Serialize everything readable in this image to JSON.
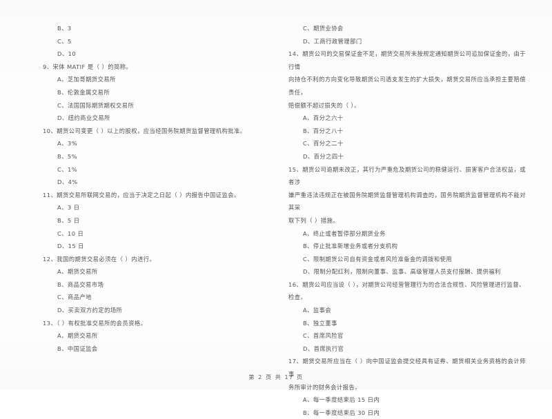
{
  "document": {
    "footer": "第 2 页  共 17 页"
  },
  "left_column": {
    "orphan_options": [
      "B、3",
      "C、5",
      "D、10"
    ],
    "questions": [
      {
        "number": "9",
        "stem_lines": [
          "9、宋体 MATIF 是（     ）的简称。"
        ],
        "options": [
          "A、芝加哥期货交易所",
          "B、伦敦金属交易所",
          "C、法国国际期货期权交易所",
          "D、纽约商业交易所"
        ]
      },
      {
        "number": "10",
        "stem_lines": [
          "10、期货公司变更（     ）以上的股权，应当经国务院期货监督管理机构批准。"
        ],
        "options": [
          "A、3%",
          "B、5%",
          "C、1%",
          "D、4%"
        ]
      },
      {
        "number": "11",
        "stem_lines": [
          "11、期货交易所联网交易的，应当于决定之日起（     ）内报告中国证监会。"
        ],
        "options": [
          "A、3 日",
          "B、5 日",
          "C、10 日",
          "D、15 日"
        ]
      },
      {
        "number": "12",
        "stem_lines": [
          "12、我国的期货交易必须在（     ）内进行。"
        ],
        "options": [
          "A、期货交易所",
          "B、商品交易市场",
          "C、商品产地",
          "D、买卖双方约定的场所"
        ]
      },
      {
        "number": "13",
        "stem_lines": [
          "13、（     ）有权批准交易所的会员资格。"
        ],
        "options": [
          "A、期货交易所",
          "B、中国证监会"
        ]
      }
    ]
  },
  "right_column": {
    "orphan_options": [
      "C、期货业协会",
      "D、工商行政管理部门"
    ],
    "questions": [
      {
        "number": "14",
        "stem_lines": [
          "14、期货公司的交易保证金不足，期货交易所未按规定通知期货公司追加保证金的，由于行情",
          "向持仓不利的方向变化导致期货公司透支发生的扩大损失，期货交易所应当承担主要赔偿责任，",
          "赔偿额不超过损失的（     ）。"
        ],
        "options": [
          "A、百分之六十",
          "B、百分之八十",
          "C、百分之二十",
          "D、百分之四十"
        ]
      },
      {
        "number": "15",
        "stem_lines": [
          "15、期货公司逾期未改正，其行为严重危及期货公司的稳健运行、损害客户合法权益，或者涉",
          "嫌严重违法违规正在被国务院期货监督管理机构调查的，国务院期货监督管理机构不能对其采",
          "取下列（     ）措施。"
        ],
        "options": [
          "A、终止或者暂停部分期货业务",
          "B、停止批准新增业务或者分支机构",
          "C、限制期货公司自有资金或者风险准备金的调拨和使用",
          "D、限制分配红利，限制向董事、监事、高级管理人员支付报酬、提供福利"
        ]
      },
      {
        "number": "16",
        "stem_lines": [
          "16、期货公司应当设（     ），对期货公司经营管理行为的合法合规性、风险管理进行监督、",
          "检查。"
        ],
        "options": [
          "A、监事会",
          "B、独立董事",
          "C、首席风险官",
          "D、首席执行官"
        ]
      },
      {
        "number": "17",
        "stem_lines": [
          "17、期货交易所应当在（     ）向中国证监会提交经具有证券、期货相关业务资格的会计师事",
          "务所审计的财务会计报告。"
        ],
        "options": [
          "A、每一季度结束后 15 日内",
          "B、每一季度结束后 30 日内"
        ]
      }
    ]
  }
}
